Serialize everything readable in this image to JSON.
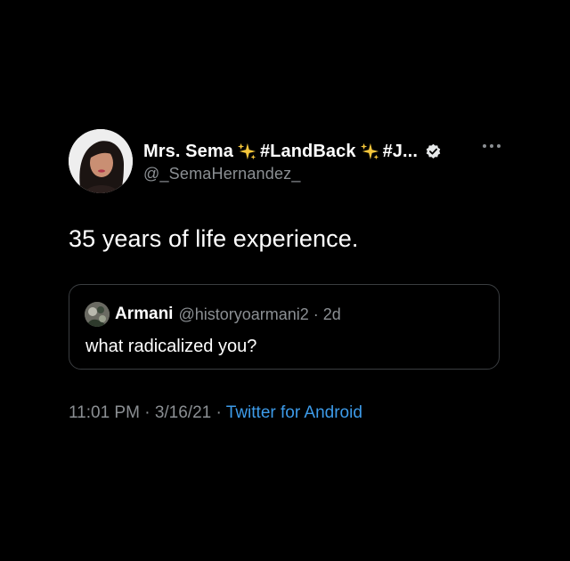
{
  "tweet": {
    "author": {
      "display_name_parts": [
        "Mrs. Sema",
        "#LandBack",
        "#J..."
      ],
      "handle": "@_SemaHernandez_",
      "avatar_icon": "profile-photo",
      "verified_icon": "verified-badge-icon",
      "emoji_icon": "sparkles-icon"
    },
    "text": "35 years of life experience.",
    "quote": {
      "author_name": "Armani",
      "author_meta": "@historyoarmani2 · 2d",
      "avatar_icon": "profile-photo",
      "text": "what radicalized you?"
    },
    "footer": {
      "time": "11:01 PM",
      "sep1": " · ",
      "date": "3/16/21",
      "sep2": " · ",
      "source": "Twitter for Android"
    }
  },
  "colors": {
    "background": "#000000",
    "primary_text": "#ffffff",
    "secondary_text": "#8b8f93",
    "link": "#3d9be9",
    "border": "#3a3d40",
    "sparkle": "#f5c63b"
  }
}
